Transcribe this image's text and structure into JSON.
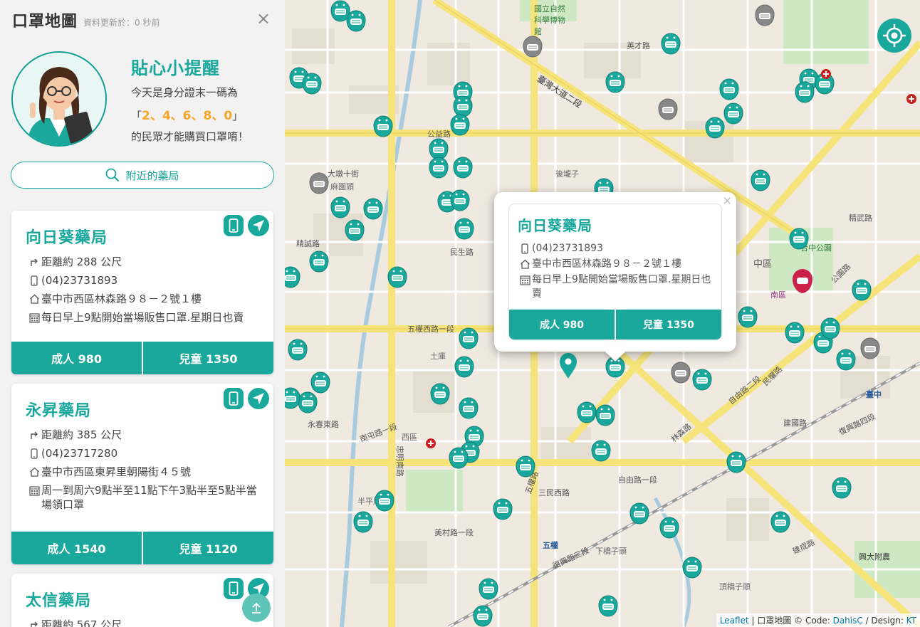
{
  "header": {
    "title": "口罩地圖",
    "update_text": "資料更新於：0 秒前",
    "close": "×"
  },
  "reminder": {
    "title": "貼心小提醒",
    "line1": "今天是身分證末一碼為",
    "open_quote": "「",
    "numbers": "2、4、6、8、0",
    "close_quote": "」",
    "line3": "的民眾才能購買口罩唷！"
  },
  "nearby": {
    "label": "附近的藥局"
  },
  "pharmacies": [
    {
      "name": "向日葵藥局",
      "distance": "距離約 288 公尺",
      "phone": "(04)23731893",
      "address": "臺中市西區林森路９８－２號１樓",
      "note": "每日早上9點開始當場販售口罩.星期日也賣",
      "adult": "成人 980",
      "child": "兒童 1350"
    },
    {
      "name": "永昇藥局",
      "distance": "距離約 385 公尺",
      "phone": "(04)23717280",
      "address": "臺中市西區東昇里朝陽街４５號",
      "note": "周一到周六9點半至11點下午3點半至5點半當場領口罩",
      "adult": "成人 1540",
      "child": "兒童 1120"
    },
    {
      "name": "太信藥局",
      "distance": "距離約 567 公尺"
    }
  ],
  "popup": {
    "name": "向日葵藥局",
    "phone": "(04)23731893",
    "address": "臺中市西區林森路９８－２號１樓",
    "note": "每日早上9點開始當場販售口罩.星期日也賣",
    "adult": "成人 980",
    "child": "兒童 1350",
    "close": "×"
  },
  "map_labels": {
    "l1": "國立自然科學博物館",
    "l2": "臺灣大道二段",
    "l3": "英才路",
    "l4": "公益路",
    "l5": "麻園頭",
    "l6": "後壠子",
    "l7": "五權西路一段",
    "l8": "民權路",
    "l9": "台中公園",
    "l10": "中區",
    "l11": "土庫",
    "l12": "西區",
    "l13": "南屯路一段",
    "l14": "五權路",
    "l15": "林森路",
    "l16": "復興路三段",
    "l17": "建國路",
    "l18": "復興路四段",
    "l19": "興大附農",
    "l20": "頂橋子頭",
    "l21": "精武路",
    "l22": "三民西路",
    "l23": "半平厝",
    "l24": "自由路一段",
    "l25": "大墩十街",
    "l26": "五權",
    "l27": "臺中",
    "l28": "自由路二段",
    "l29": "民生路",
    "l30": "公園路",
    "l31": "南區",
    "l32": "下橋子頭",
    "l33": "建成路",
    "l34": "忠明南路",
    "l35": "美村路一段",
    "l36": "永春東路",
    "l37": "精誠路"
  },
  "attribution": {
    "leaflet": "Leaflet",
    "sep1": " | 口罩地圖 © Code: ",
    "code": "DahisC",
    "sep2": " / Design: ",
    "design": "KT"
  },
  "colors": {
    "teal": "#1aa89d",
    "orange": "#f5a623",
    "marker_gray": "#888888",
    "marker_red": "#cc1f4a"
  }
}
